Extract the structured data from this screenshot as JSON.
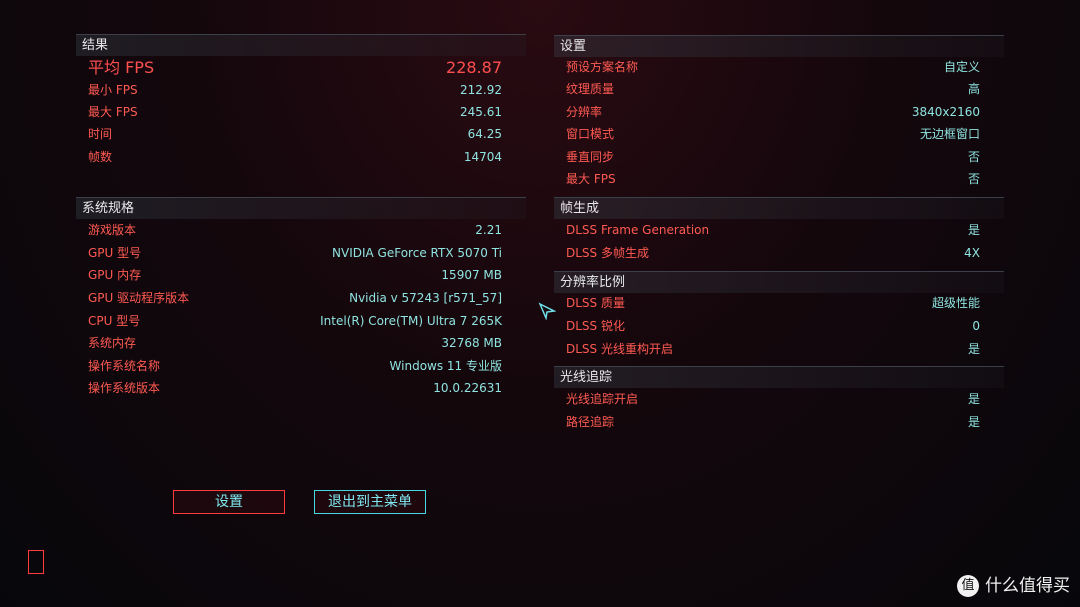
{
  "results": {
    "header": "结果",
    "avg_fps": {
      "label": "平均 FPS",
      "value": "228.87"
    },
    "rows": [
      {
        "label": "最小 FPS",
        "value": "212.92"
      },
      {
        "label": "最大 FPS",
        "value": "245.61"
      },
      {
        "label": "时间",
        "value": "64.25"
      },
      {
        "label": "帧数",
        "value": "14704"
      }
    ]
  },
  "system": {
    "header": "系统规格",
    "rows": [
      {
        "label": "游戏版本",
        "value": "2.21"
      },
      {
        "label": "GPU 型号",
        "value": "NVIDIA GeForce RTX 5070 Ti"
      },
      {
        "label": "GPU 内存",
        "value": "15907 MB"
      },
      {
        "label": "GPU 驱动程序版本",
        "value": "Nvidia v 57243 [r571_57]"
      },
      {
        "label": "CPU 型号",
        "value": "Intel(R) Core(TM) Ultra 7 265K"
      },
      {
        "label": "系统内存",
        "value": "32768 MB"
      },
      {
        "label": "操作系统名称",
        "value": "Windows 11 专业版"
      },
      {
        "label": "操作系统版本",
        "value": "10.0.22631"
      }
    ]
  },
  "settings": {
    "header": "设置",
    "rows": [
      {
        "label": "预设方案名称",
        "value": "自定义"
      },
      {
        "label": "纹理质量",
        "value": "高"
      },
      {
        "label": "分辨率",
        "value": "3840x2160"
      },
      {
        "label": "窗口模式",
        "value": "无边框窗口"
      },
      {
        "label": "垂直同步",
        "value": "否"
      },
      {
        "label": "最大 FPS",
        "value": "否"
      }
    ]
  },
  "framegen": {
    "header": "帧生成",
    "rows": [
      {
        "label": "DLSS Frame Generation",
        "value": "是"
      },
      {
        "label": "DLSS 多帧生成",
        "value": "4X"
      }
    ]
  },
  "scaling": {
    "header": "分辨率比例",
    "rows": [
      {
        "label": "DLSS 质量",
        "value": "超级性能"
      },
      {
        "label": "DLSS 锐化",
        "value": "0"
      },
      {
        "label": "DLSS 光线重构开启",
        "value": "是"
      }
    ]
  },
  "raytracing": {
    "header": "光线追踪",
    "rows": [
      {
        "label": "光线追踪开启",
        "value": "是"
      },
      {
        "label": "路径追踪",
        "value": "是"
      }
    ]
  },
  "buttons": {
    "settings": "设置",
    "exit": "退出到主菜单"
  },
  "watermark": {
    "logo": "值",
    "text": "什么值得买"
  },
  "colors": {
    "label": "#ff5a52",
    "value": "#8fe3e0",
    "accent": "#ff3b3b"
  }
}
